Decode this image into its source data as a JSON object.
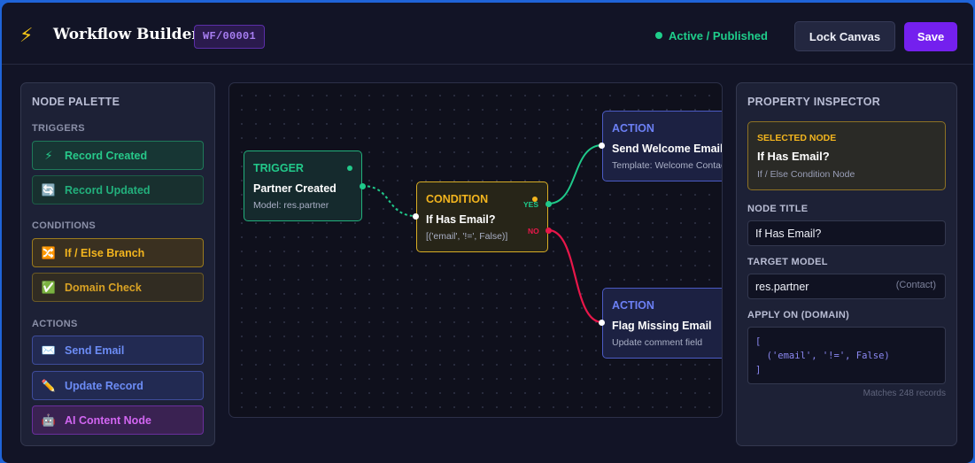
{
  "header": {
    "logo_icon": "lightning-icon",
    "title": "Workflow Builder",
    "workflow_id": "WF/00001",
    "status": "Active / Published",
    "lock_label": "Lock Canvas",
    "save_label": "Save"
  },
  "palette": {
    "title": "NODE PALETTE",
    "sections": {
      "triggers": "TRIGGERS",
      "conditions": "CONDITIONS",
      "actions": "ACTIONS"
    },
    "items": [
      {
        "label": "Record Created",
        "icon": "⚡",
        "icon_name": "lightning-icon"
      },
      {
        "label": "Record Updated",
        "icon": "🔄",
        "icon_name": "refresh-icon"
      },
      {
        "label": "If / Else Branch",
        "icon": "🔀",
        "icon_name": "shuffle-icon"
      },
      {
        "label": "Domain Check",
        "icon": "✅",
        "icon_name": "check-icon"
      },
      {
        "label": "Send Email",
        "icon": "✉️",
        "icon_name": "envelope-icon"
      },
      {
        "label": "Update Record",
        "icon": "✏️",
        "icon_name": "pencil-icon"
      },
      {
        "label": "AI Content Node",
        "icon": "🤖",
        "icon_name": "robot-icon"
      }
    ]
  },
  "canvas": {
    "nodes": {
      "trigger": {
        "type": "TRIGGER",
        "title": "Partner Created",
        "subtitle": "Model: res.partner"
      },
      "condition": {
        "type": "CONDITION",
        "title": "If Has Email?",
        "subtitle": "[('email', '!=', False)]",
        "yes_label": "YES",
        "no_label": "NO"
      },
      "action_email": {
        "type": "ACTION",
        "title": "Send Welcome Email",
        "subtitle": "Template: Welcome Contact"
      },
      "action_flag": {
        "type": "ACTION",
        "title": "Flag Missing Email",
        "subtitle": "Update comment field"
      }
    },
    "colors": {
      "yes_wire": "#1fc98a",
      "no_wire": "#e8174a",
      "trigger_wire": "#1fc98a"
    }
  },
  "inspector": {
    "title": "PROPERTY INSPECTOR",
    "selected": {
      "label": "SELECTED NODE",
      "title": "If Has Email?",
      "subtitle": "If / Else Condition Node"
    },
    "node_title_label": "NODE TITLE",
    "node_title_value": "If Has Email?",
    "target_model_label": "TARGET MODEL",
    "target_model_value": "res.partner",
    "target_model_hint": "(Contact)",
    "domain_label": "APPLY ON (DOMAIN)",
    "domain_lines": [
      "[",
      "  ('email', '!=', False)",
      "]"
    ],
    "matches": "Matches 248 records"
  }
}
